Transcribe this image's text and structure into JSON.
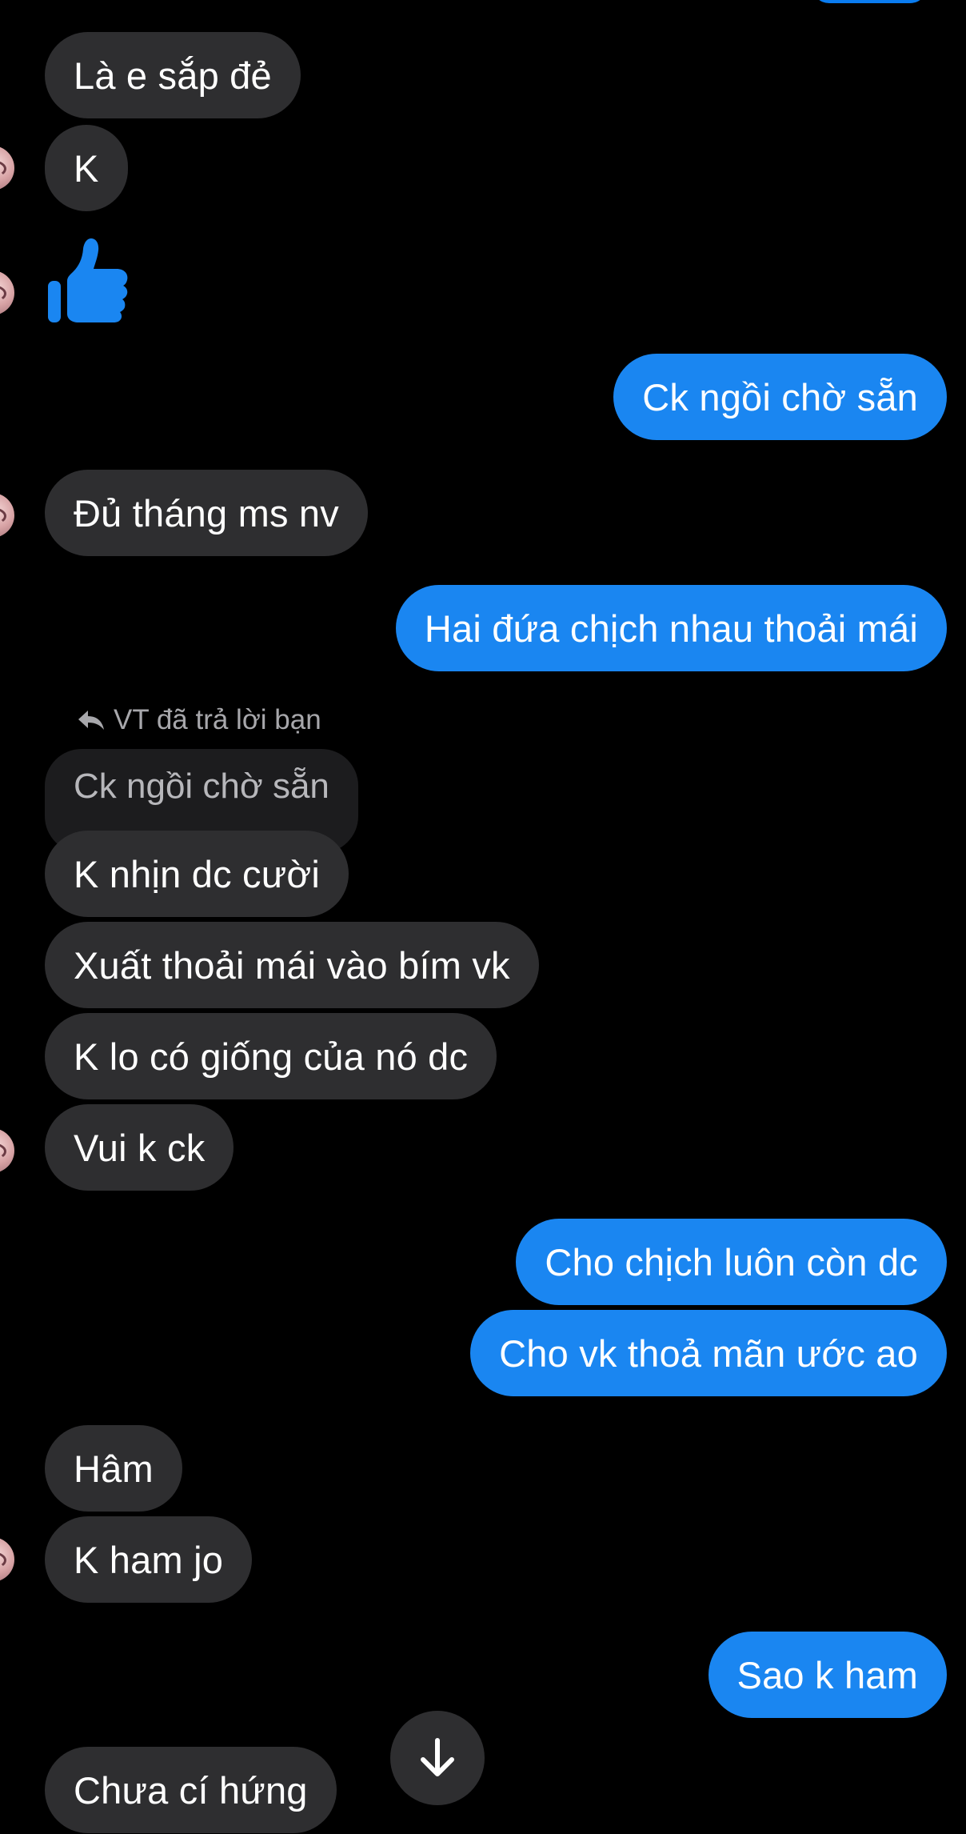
{
  "colors": {
    "background": "#000000",
    "incoming_bubble": "#2e2e30",
    "outgoing_bubble": "#1a86f1",
    "reply_quote_bubble": "#1c1c1e",
    "reply_note_text": "#a7a7ab"
  },
  "icons": {
    "reaction": "thumbs-up-icon",
    "reply": "reply-arrow-icon",
    "scroll": "arrow-down-icon"
  },
  "messages": [
    {
      "side": "incoming",
      "text": "Là e sắp đẻ"
    },
    {
      "side": "incoming",
      "text": "K"
    },
    {
      "side": "incoming",
      "type": "reaction",
      "icon": "thumbs-up-icon"
    },
    {
      "side": "outgoing",
      "text": "Ck ngồi chờ sẵn"
    },
    {
      "side": "incoming",
      "text": "Đủ tháng ms nv"
    },
    {
      "side": "outgoing",
      "text": "Hai đứa chịch nhau thoải mái"
    },
    {
      "side": "incoming",
      "text": "K nhịn dc cười"
    },
    {
      "side": "incoming",
      "text": "Xuất thoải mái vào bím vk"
    },
    {
      "side": "incoming",
      "text": "K lo có giống của nó dc"
    },
    {
      "side": "incoming",
      "text": "Vui k ck"
    },
    {
      "side": "outgoing",
      "text": "Cho chịch luôn còn dc"
    },
    {
      "side": "outgoing",
      "text": "Cho vk thoả mãn ước ao"
    },
    {
      "side": "incoming",
      "text": "Hâm"
    },
    {
      "side": "incoming",
      "text": "K ham jo"
    },
    {
      "side": "outgoing",
      "text": "Sao k ham"
    },
    {
      "side": "incoming",
      "text": "Chưa cí hứng"
    }
  ],
  "reply": {
    "note": "VT đã trả lời bạn",
    "quoted_text": "Ck ngồi chờ sẵn"
  }
}
